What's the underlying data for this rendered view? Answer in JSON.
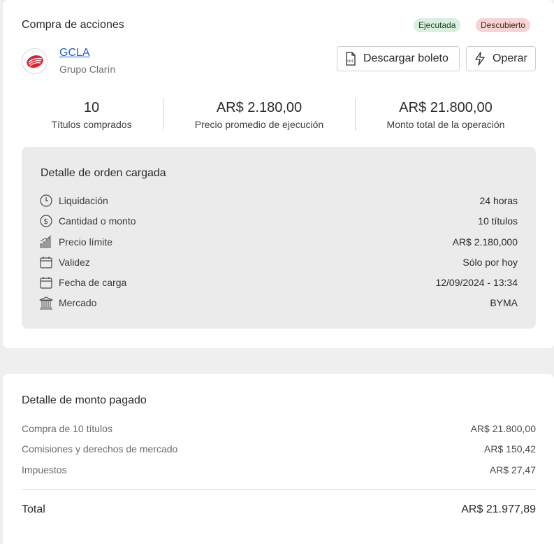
{
  "header": {
    "title": "Compra de acciones",
    "badges": [
      {
        "label": "Ejecutada",
        "color": "#d8f0dd"
      },
      {
        "label": "Descubierto",
        "color": "#f6d4d4"
      }
    ]
  },
  "instrument": {
    "ticker": "GCLA",
    "company": "Grupo Clarín",
    "logo": "clarin-logo",
    "brand_color": "#e2202a"
  },
  "actions": {
    "download_label": "Descargar boleto",
    "download_icon": "pdf-file-icon",
    "operate_label": "Operar",
    "operate_icon": "lightning-icon"
  },
  "stats": [
    {
      "value": "10",
      "label": "Títulos comprados"
    },
    {
      "value": "AR$ 2.180,00",
      "label": "Precio promedio de ejecución"
    },
    {
      "value": "AR$ 21.800,00",
      "label": "Monto total de la operación"
    }
  ],
  "order_detail": {
    "title": "Detalle de orden cargada",
    "rows": [
      {
        "icon": "clock-icon",
        "label": "Liquidación",
        "value": "24 horas"
      },
      {
        "icon": "dollar-circle-icon",
        "label": "Cantidad o monto",
        "value": "10 títulos"
      },
      {
        "icon": "bar-chart-icon",
        "label": "Precio límite",
        "value": "AR$ 2.180,000"
      },
      {
        "icon": "calendar-icon",
        "label": "Validez",
        "value": "Sólo por hoy"
      },
      {
        "icon": "calendar-icon",
        "label": "Fecha de carga",
        "value": "12/09/2024 - 13:34"
      },
      {
        "icon": "bank-icon",
        "label": "Mercado",
        "value": "BYMA"
      }
    ]
  },
  "payment": {
    "title": "Detalle de monto pagado",
    "rows": [
      {
        "label": "Compra de 10 títulos",
        "value": "AR$ 21.800,00"
      },
      {
        "label": "Comisiones y derechos de mercado",
        "value": "AR$ 150,42"
      },
      {
        "label": "Impuestos",
        "value": "AR$ 27,47"
      }
    ],
    "total_label": "Total",
    "total_value": "AR$ 21.977,89"
  }
}
